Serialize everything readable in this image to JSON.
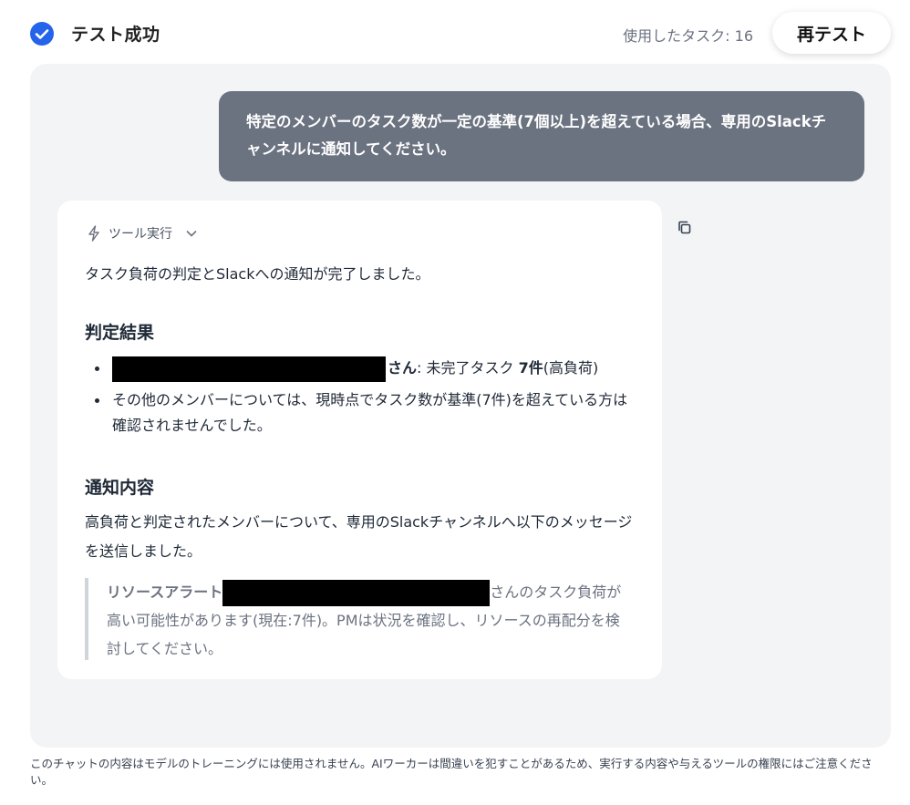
{
  "header": {
    "title": "テスト成功",
    "tasks_used": "使用したタスク: 16",
    "retest_label": "再テスト",
    "accent": "#2563eb"
  },
  "user_message": {
    "text": "特定のメンバーのタスク数が一定の基準(7個以上)を超えている場合、専用のSlackチャンネルに通知してください。"
  },
  "ai_message": {
    "tool_label": "ツール実行",
    "intro": "タスク負荷の判定とSlackへの通知が完了しました。",
    "result_heading": "判定結果",
    "result_items": [
      {
        "suffix": "さん",
        "colon_text": ": 未完了タスク ",
        "bold_count": "7件",
        "tail": "(高負荷)"
      },
      {
        "text": "その他のメンバーについては、現時点でタスク数が基準(7件)を超えている方は確認されませんでした。"
      }
    ],
    "notify_heading": "通知内容",
    "notify_text": "高負荷と判定されたメンバーについて、専用のSlackチャンネルへ以下のメッセージを送信しました。",
    "quote": {
      "prefix": "リソースアラート",
      "after_redaction": "さんのタスク負荷が高い可能性があります(現在:7件)。PMは状況を確認し、リソースの再配分を検討してください。"
    }
  },
  "footer": {
    "text": "このチャットの内容はモデルのトレーニングには使用されません。AIワーカーは間違いを犯すことがあるため、実行する内容や与えるツールの権限にはご注意ください。"
  }
}
